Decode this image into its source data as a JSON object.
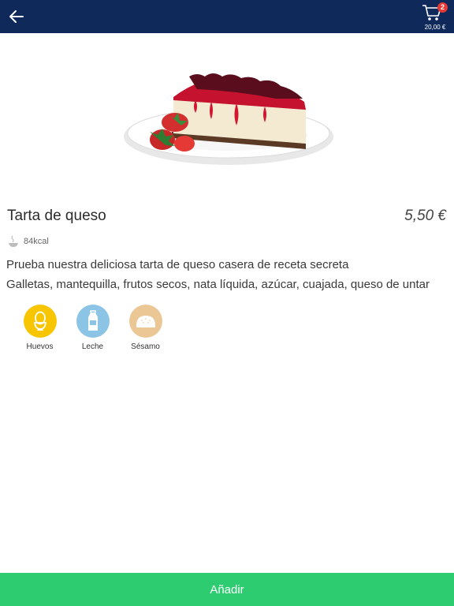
{
  "header": {
    "cart": {
      "count": "2",
      "total": "20,00 €"
    }
  },
  "product": {
    "title": "Tarta de queso",
    "price": "5,50 €",
    "kcal": "84kcal",
    "description": "Prueba nuestra deliciosa tarta de queso casera de receta secreta",
    "ingredients": "Galletas, mantequilla, frutos secos, nata líquida, azúcar, cuajada, queso de untar",
    "image_icon": "cheesecake-image"
  },
  "allergens": [
    {
      "label": "Huevos",
      "icon": "egg-icon",
      "color": "#f7c600"
    },
    {
      "label": "Leche",
      "icon": "milk-icon",
      "color": "#8cc4e6"
    },
    {
      "label": "Sésamo",
      "icon": "sesame-bun-icon",
      "color": "#ebc795"
    }
  ],
  "actions": {
    "add_label": "Añadir"
  },
  "colors": {
    "header": "#0f2a5a",
    "add_button": "#2ecc71",
    "badge": "#e53935"
  }
}
